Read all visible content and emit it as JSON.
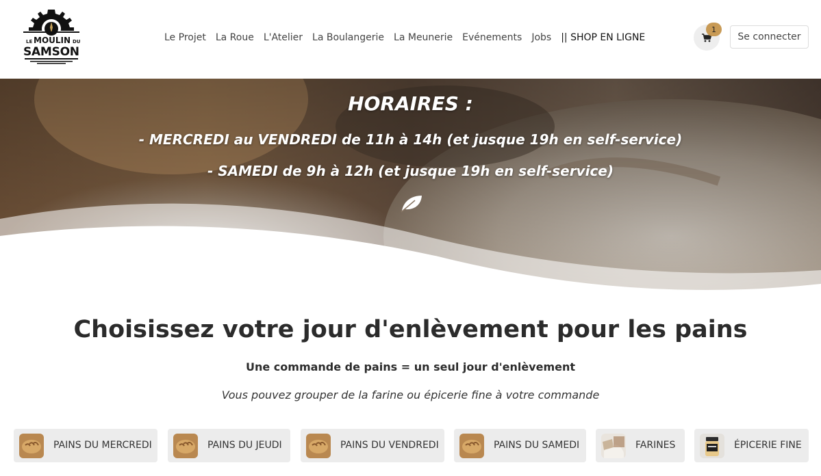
{
  "header": {
    "logo": {
      "line1": "LE",
      "line2": "MOULIN",
      "line3": "DU",
      "line4": "SAMSON"
    },
    "nav": [
      {
        "label": "Le Projet"
      },
      {
        "label": "La Roue"
      },
      {
        "label": "L'Atelier"
      },
      {
        "label": "La Boulangerie"
      },
      {
        "label": "La Meunerie"
      },
      {
        "label": "Evénements"
      },
      {
        "label": "Jobs"
      },
      {
        "label": "|| SHOP EN LIGNE"
      }
    ],
    "cart": {
      "icon": "cart-icon",
      "count": "1"
    },
    "login_label": "Se connecter"
  },
  "hero": {
    "title": "HORAIRES :",
    "line1": "- MERCREDI au VENDREDI de 11h à 14h (et jusque 19h en self-service)",
    "line2": "- SAMEDI de 9h à 12h (et jusque 19h en self-service)",
    "icon": "leaf-icon"
  },
  "section": {
    "headline": "Choisissez votre jour d'enlèvement pour les pains",
    "subtitle": "Une commande de pains = un seul jour d'enlèvement",
    "note": "Vous pouvez grouper de la farine ou épicerie fine à votre commande"
  },
  "categories": [
    {
      "label": "PAINS DU MERCREDI",
      "icon": "bread-icon"
    },
    {
      "label": "PAINS DU JEUDI",
      "icon": "bread-icon"
    },
    {
      "label": "PAINS DU VENDREDI",
      "icon": "bread-icon"
    },
    {
      "label": "PAINS DU SAMEDI",
      "icon": "bread-icon"
    },
    {
      "label": "FARINES",
      "icon": "flour-icon"
    },
    {
      "label": "ÉPICERIE FINE",
      "icon": "jar-icon"
    }
  ],
  "colors": {
    "badge": "#c89a55",
    "button_bg": "#ececec",
    "text_dark": "#2b2b2b"
  }
}
